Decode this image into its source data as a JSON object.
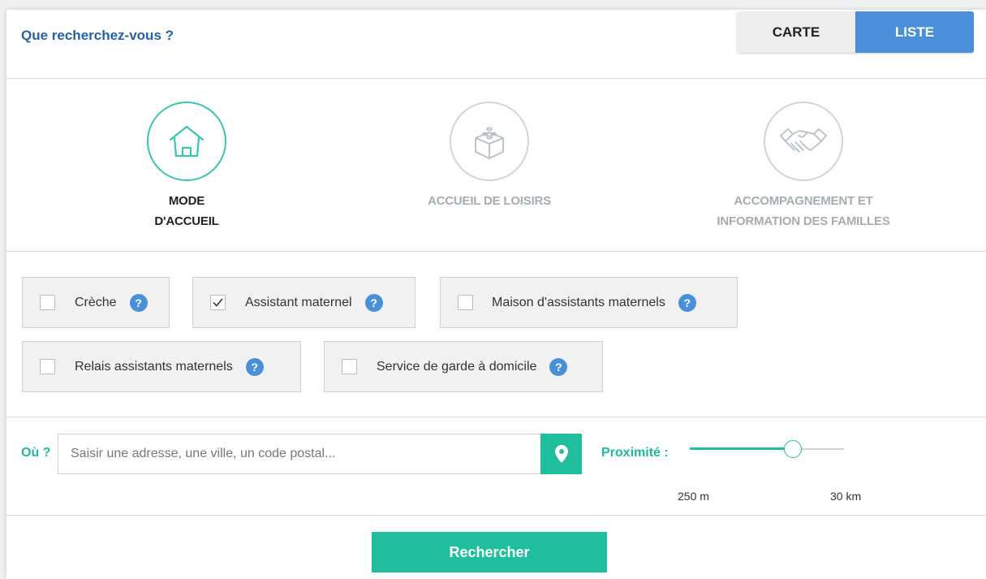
{
  "header": {
    "title": "Que recherchez-vous ?"
  },
  "view_toggle": {
    "map_label": "CARTE",
    "list_label": "LISTE",
    "selected": "LISTE"
  },
  "categories": [
    {
      "label_lines": [
        "MODE D'ACCUEIL"
      ],
      "icon": "house-icon",
      "active": true
    },
    {
      "label_lines": [
        "ACCUEIL DE LOISIRS"
      ],
      "icon": "toy-block-icon",
      "active": false
    },
    {
      "label_lines": [
        "ACCOMPAGNEMENT ET",
        "INFORMATION DES FAMILLES"
      ],
      "icon": "handshake-icon",
      "active": false
    }
  ],
  "care_types": [
    {
      "label": "Crèche",
      "checked": false
    },
    {
      "label": "Assistant maternel",
      "checked": true
    },
    {
      "label": "Maison d'assistants maternels",
      "checked": false
    },
    {
      "label": "Relais assistants maternels",
      "checked": false
    },
    {
      "label": "Service de garde à domicile",
      "checked": false
    }
  ],
  "help_glyph": "?",
  "location": {
    "label": "Où ?",
    "value": "",
    "placeholder": "Saisir une adresse, une ville, un code postal...",
    "locate_icon": "map-pin-icon"
  },
  "proximity": {
    "label": "Proximité :",
    "min_label": "250 m",
    "max_label": "30 km",
    "level": 0.67
  },
  "submit": {
    "label": "Rechercher"
  },
  "colors": {
    "accent": "#1fbf9e",
    "primary": "#4a90d9",
    "title": "#2561a8"
  }
}
